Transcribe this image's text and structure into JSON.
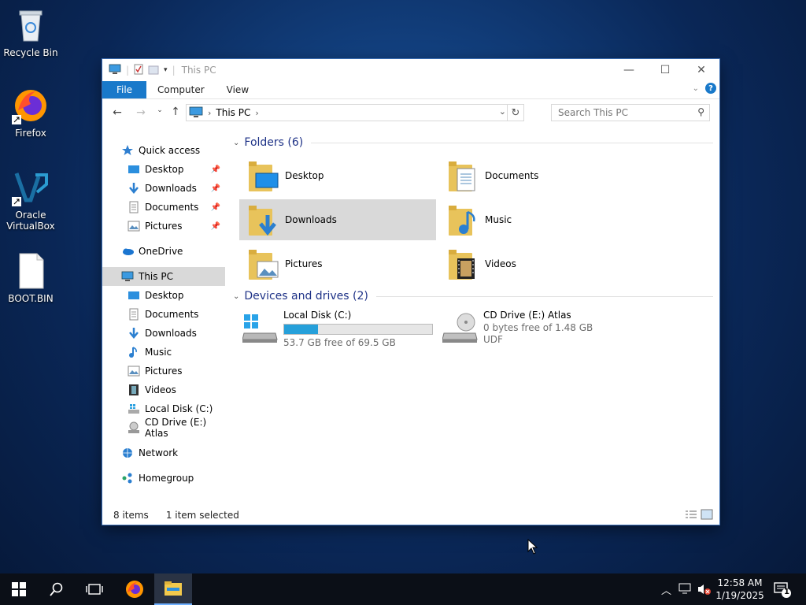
{
  "desktop": {
    "icons": [
      {
        "label": "Recycle Bin",
        "icon": "recycle-bin-icon"
      },
      {
        "label": "Firefox",
        "icon": "firefox-icon"
      },
      {
        "label": "Oracle VirtualBox",
        "icon": "virtualbox-icon"
      },
      {
        "label": "BOOT.BIN",
        "icon": "file-icon"
      }
    ]
  },
  "window": {
    "title": "This PC",
    "ribbon_tabs": [
      "File",
      "Computer",
      "View"
    ],
    "address": {
      "crumb": "This PC"
    },
    "search": {
      "placeholder": "Search This PC"
    },
    "sidebar": {
      "quick_access": "Quick access",
      "quick_items": [
        "Desktop",
        "Downloads",
        "Documents",
        "Pictures"
      ],
      "onedrive": "OneDrive",
      "this_pc": "This PC",
      "pc_items": [
        "Desktop",
        "Documents",
        "Downloads",
        "Music",
        "Pictures",
        "Videos",
        "Local Disk (C:)",
        "CD Drive (E:) Atlas"
      ],
      "network": "Network",
      "homegroup": "Homegroup"
    },
    "folders_header": "Folders (6)",
    "folders": [
      "Desktop",
      "Documents",
      "Downloads",
      "Music",
      "Pictures",
      "Videos"
    ],
    "selected_folder": "Downloads",
    "drives_header": "Devices and drives (2)",
    "drives": [
      {
        "name": "Local Disk (C:)",
        "free": "53.7 GB free of 69.5 GB",
        "used_fraction": 0.227
      },
      {
        "name": "CD Drive (E:) Atlas",
        "free": "0 bytes free of 1.48 GB",
        "fs": "UDF"
      }
    ],
    "status": {
      "items": "8 items",
      "selected": "1 item selected"
    }
  },
  "taskbar": {
    "time": "12:58 AM",
    "date": "1/19/2025",
    "notification_count": "1"
  },
  "colors": {
    "accent": "#1979ca",
    "selection": "#d9d9d9",
    "drive_bar": "#26a0da",
    "folder": "#e8c35b"
  }
}
